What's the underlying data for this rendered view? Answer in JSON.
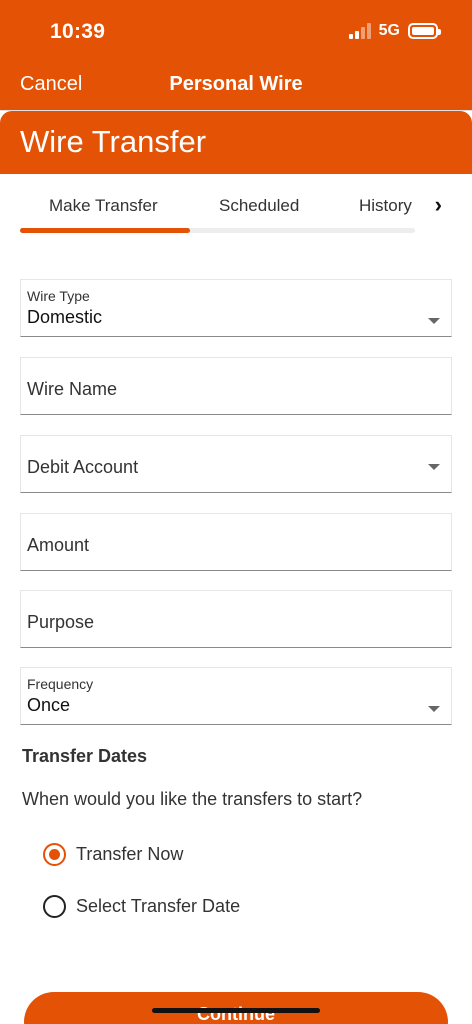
{
  "status_bar": {
    "time": "10:39",
    "network": "5G"
  },
  "nav": {
    "cancel_label": "Cancel",
    "title": "Personal Wire"
  },
  "page": {
    "title": "Wire Transfer"
  },
  "tabs": [
    {
      "label": "Make Transfer",
      "active": true
    },
    {
      "label": "Scheduled",
      "active": false
    },
    {
      "label": "History",
      "active": false
    }
  ],
  "form": {
    "wire_type": {
      "label": "Wire Type",
      "value": "Domestic"
    },
    "wire_name": {
      "placeholder": "Wire Name"
    },
    "debit_account": {
      "placeholder": "Debit Account"
    },
    "amount": {
      "placeholder": "Amount"
    },
    "purpose": {
      "placeholder": "Purpose"
    },
    "frequency": {
      "label": "Frequency",
      "value": "Once"
    }
  },
  "transfer_dates": {
    "title": "Transfer Dates",
    "question": "When would you like the transfers to start?",
    "options": [
      {
        "label": "Transfer Now",
        "selected": true
      },
      {
        "label": "Select Transfer Date",
        "selected": false
      }
    ]
  },
  "continue_label": "Continue",
  "colors": {
    "accent": "#E35205"
  },
  "icons": {
    "tabs_scroll": "chevron-right-icon",
    "dropdown": "caret-down-icon"
  }
}
